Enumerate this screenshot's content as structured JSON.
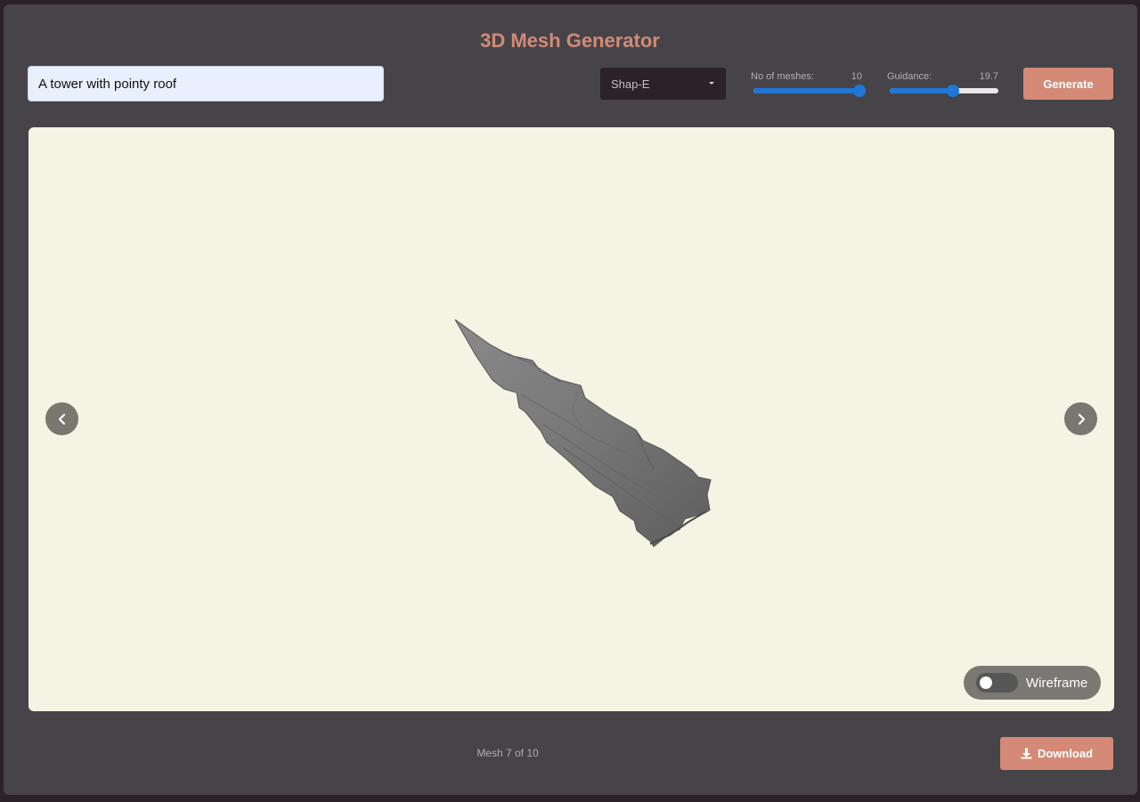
{
  "header": {
    "title": "3D Mesh Generator"
  },
  "prompt": {
    "value": "A tower with pointy roof"
  },
  "model_select": {
    "selected": "Shap-E"
  },
  "mesh_count_slider": {
    "label": "No of meshes:",
    "value": "10",
    "fraction": 1.0
  },
  "guidance_slider": {
    "label": "Guidance:",
    "value": "19.7",
    "fraction": 0.58
  },
  "generate": {
    "label": "Generate"
  },
  "viewer": {
    "prev_icon": "chevron-left-icon",
    "next_icon": "chevron-right-icon",
    "wireframe": {
      "label": "Wireframe",
      "enabled": false
    }
  },
  "footer": {
    "counter": "Mesh 7 of 10",
    "download_label": "Download",
    "download_icon": "download-icon"
  },
  "colors": {
    "accent": "#d48a76",
    "panel": "#464448",
    "viewer_bg": "#f5f3e3",
    "slider": "#1f77d6"
  }
}
